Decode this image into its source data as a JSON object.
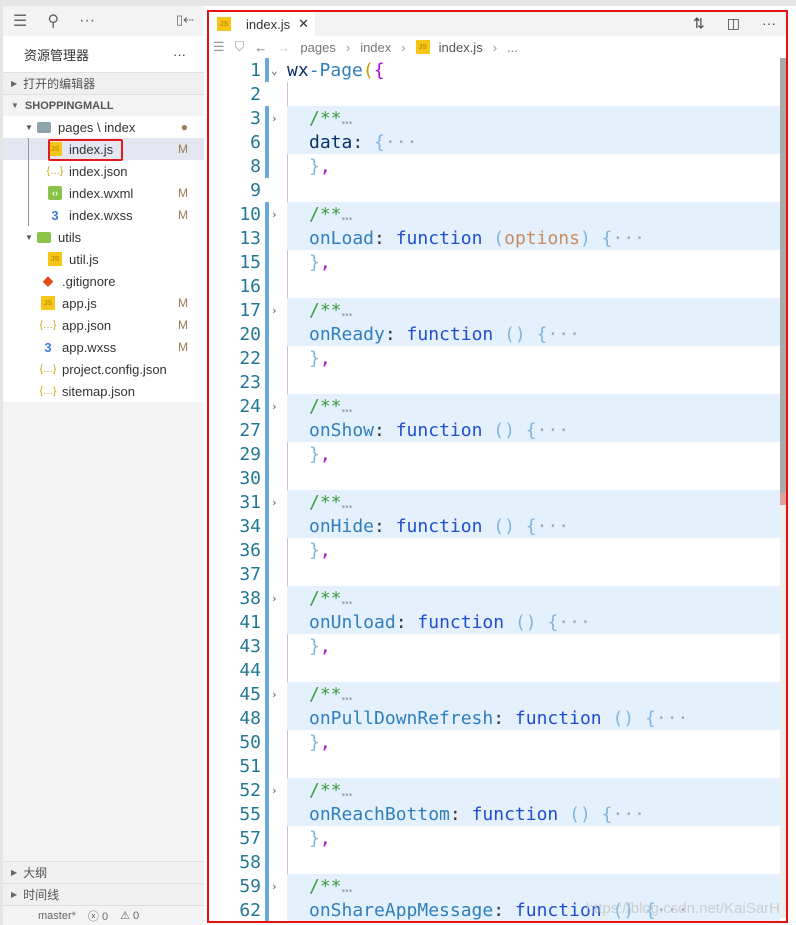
{
  "sidebar": {
    "title": "资源管理器",
    "more": "···",
    "sections": {
      "open_editors": "打开的编辑器",
      "project": "SHOPPINGMALL",
      "outline": "大纲",
      "timeline": "时间线"
    },
    "tree": [
      {
        "name": "pages \\ index",
        "type": "folder",
        "depth": 1,
        "expanded": true,
        "badge": "●"
      },
      {
        "name": "index.js",
        "type": "js",
        "depth": 2,
        "badge": "M",
        "selected": true
      },
      {
        "name": "index.json",
        "type": "json",
        "depth": 2,
        "badge": ""
      },
      {
        "name": "index.wxml",
        "type": "wxml",
        "depth": 2,
        "badge": "M"
      },
      {
        "name": "index.wxss",
        "type": "css",
        "depth": 2,
        "badge": "M"
      },
      {
        "name": "utils",
        "type": "folderg",
        "depth": 1,
        "expanded": true,
        "badge": ""
      },
      {
        "name": "util.js",
        "type": "js",
        "depth": 2,
        "badge": ""
      },
      {
        "name": ".gitignore",
        "type": "git",
        "depth": 1,
        "badge": ""
      },
      {
        "name": "app.js",
        "type": "js",
        "depth": 1,
        "badge": "M"
      },
      {
        "name": "app.json",
        "type": "json",
        "depth": 1,
        "badge": "M"
      },
      {
        "name": "app.wxss",
        "type": "css",
        "depth": 1,
        "badge": "M"
      },
      {
        "name": "project.config.json",
        "type": "json",
        "depth": 1,
        "badge": ""
      },
      {
        "name": "sitemap.json",
        "type": "json",
        "depth": 1,
        "badge": ""
      }
    ],
    "status": {
      "branch": "master*",
      "errors": "ⓧ 0",
      "warnings": "⚠ 0"
    }
  },
  "editor": {
    "tab": "index.js",
    "breadcrumb": [
      "pages",
      "index",
      "index.js",
      "..."
    ],
    "lines": [
      {
        "n": "1",
        "fold": "open",
        "toks": [
          [
            "t-id",
            "wx"
          ],
          [
            "t-fn",
            "-Page"
          ],
          [
            "t-p",
            "("
          ],
          [
            "t-b",
            "{"
          ]
        ]
      },
      {
        "n": "2",
        "toks": []
      },
      {
        "n": "3",
        "fold": "closed",
        "hl": true,
        "ind": true,
        "toks": [
          [
            "t-cm",
            "/**"
          ],
          [
            "t-dim",
            "…"
          ]
        ]
      },
      {
        "n": "6",
        "hl": true,
        "ind": true,
        "toks": [
          [
            "t-id",
            "data"
          ],
          [
            "t-pl",
            ": "
          ],
          [
            "t-par",
            "{"
          ],
          [
            "t-dim",
            "···"
          ]
        ]
      },
      {
        "n": "8",
        "ind": true,
        "toks": [
          [
            "t-par",
            "}"
          ],
          [
            "t-b",
            ","
          ]
        ]
      },
      {
        "n": "9",
        "toks": []
      },
      {
        "n": "10",
        "fold": "closed",
        "hl": true,
        "ind": true,
        "toks": [
          [
            "t-cm",
            "/**"
          ],
          [
            "t-dim",
            "…"
          ]
        ]
      },
      {
        "n": "13",
        "hl": true,
        "ind": true,
        "toks": [
          [
            "t-fn",
            "onLoad"
          ],
          [
            "t-pl",
            ": "
          ],
          [
            "t-kw",
            "function "
          ],
          [
            "t-par",
            "("
          ],
          [
            "t-arg",
            "options"
          ],
          [
            "t-par",
            ") {"
          ],
          [
            "t-dim",
            "···"
          ]
        ]
      },
      {
        "n": "15",
        "ind": true,
        "toks": [
          [
            "t-par",
            "}"
          ],
          [
            "t-b",
            ","
          ]
        ]
      },
      {
        "n": "16",
        "toks": []
      },
      {
        "n": "17",
        "fold": "closed",
        "hl": true,
        "ind": true,
        "toks": [
          [
            "t-cm",
            "/**"
          ],
          [
            "t-dim",
            "…"
          ]
        ]
      },
      {
        "n": "20",
        "hl": true,
        "ind": true,
        "toks": [
          [
            "t-fn",
            "onReady"
          ],
          [
            "t-pl",
            ": "
          ],
          [
            "t-kw",
            "function "
          ],
          [
            "t-par",
            "() {"
          ],
          [
            "t-dim",
            "···"
          ]
        ]
      },
      {
        "n": "22",
        "ind": true,
        "toks": [
          [
            "t-par",
            "}"
          ],
          [
            "t-b",
            ","
          ]
        ]
      },
      {
        "n": "23",
        "toks": []
      },
      {
        "n": "24",
        "fold": "closed",
        "hl": true,
        "ind": true,
        "toks": [
          [
            "t-cm",
            "/**"
          ],
          [
            "t-dim",
            "…"
          ]
        ]
      },
      {
        "n": "27",
        "hl": true,
        "ind": true,
        "toks": [
          [
            "t-fn",
            "onShow"
          ],
          [
            "t-pl",
            ": "
          ],
          [
            "t-kw",
            "function "
          ],
          [
            "t-par",
            "() {"
          ],
          [
            "t-dim",
            "···"
          ]
        ]
      },
      {
        "n": "29",
        "ind": true,
        "toks": [
          [
            "t-par",
            "}"
          ],
          [
            "t-b",
            ","
          ]
        ]
      },
      {
        "n": "30",
        "toks": []
      },
      {
        "n": "31",
        "fold": "closed",
        "hl": true,
        "ind": true,
        "toks": [
          [
            "t-cm",
            "/**"
          ],
          [
            "t-dim",
            "…"
          ]
        ]
      },
      {
        "n": "34",
        "hl": true,
        "ind": true,
        "toks": [
          [
            "t-fn",
            "onHide"
          ],
          [
            "t-pl",
            ": "
          ],
          [
            "t-kw",
            "function "
          ],
          [
            "t-par",
            "() {"
          ],
          [
            "t-dim",
            "···"
          ]
        ]
      },
      {
        "n": "36",
        "ind": true,
        "toks": [
          [
            "t-par",
            "}"
          ],
          [
            "t-b",
            ","
          ]
        ]
      },
      {
        "n": "37",
        "toks": []
      },
      {
        "n": "38",
        "fold": "closed",
        "hl": true,
        "ind": true,
        "toks": [
          [
            "t-cm",
            "/**"
          ],
          [
            "t-dim",
            "…"
          ]
        ]
      },
      {
        "n": "41",
        "hl": true,
        "ind": true,
        "toks": [
          [
            "t-fn",
            "onUnload"
          ],
          [
            "t-pl",
            ": "
          ],
          [
            "t-kw",
            "function "
          ],
          [
            "t-par",
            "() {"
          ],
          [
            "t-dim",
            "···"
          ]
        ]
      },
      {
        "n": "43",
        "ind": true,
        "toks": [
          [
            "t-par",
            "}"
          ],
          [
            "t-b",
            ","
          ]
        ]
      },
      {
        "n": "44",
        "toks": []
      },
      {
        "n": "45",
        "fold": "closed",
        "hl": true,
        "ind": true,
        "toks": [
          [
            "t-cm",
            "/**"
          ],
          [
            "t-dim",
            "…"
          ]
        ]
      },
      {
        "n": "48",
        "hl": true,
        "ind": true,
        "toks": [
          [
            "t-fn",
            "onPullDownRefresh"
          ],
          [
            "t-pl",
            ": "
          ],
          [
            "t-kw",
            "function "
          ],
          [
            "t-par",
            "() {"
          ],
          [
            "t-dim",
            "···"
          ]
        ]
      },
      {
        "n": "50",
        "ind": true,
        "toks": [
          [
            "t-par",
            "}"
          ],
          [
            "t-b",
            ","
          ]
        ]
      },
      {
        "n": "51",
        "toks": []
      },
      {
        "n": "52",
        "fold": "closed",
        "hl": true,
        "ind": true,
        "toks": [
          [
            "t-cm",
            "/**"
          ],
          [
            "t-dim",
            "…"
          ]
        ]
      },
      {
        "n": "55",
        "hl": true,
        "ind": true,
        "toks": [
          [
            "t-fn",
            "onReachBottom"
          ],
          [
            "t-pl",
            ": "
          ],
          [
            "t-kw",
            "function "
          ],
          [
            "t-par",
            "() {"
          ],
          [
            "t-dim",
            "···"
          ]
        ]
      },
      {
        "n": "57",
        "ind": true,
        "toks": [
          [
            "t-par",
            "}"
          ],
          [
            "t-b",
            ","
          ]
        ]
      },
      {
        "n": "58",
        "toks": []
      },
      {
        "n": "59",
        "fold": "closed",
        "hl": true,
        "ind": true,
        "toks": [
          [
            "t-cm",
            "/**"
          ],
          [
            "t-dim",
            "…"
          ]
        ]
      },
      {
        "n": "62",
        "hl": true,
        "ind": true,
        "toks": [
          [
            "t-fn",
            "onShareAppMessage"
          ],
          [
            "t-pl",
            ": "
          ],
          [
            "t-kw",
            "function "
          ],
          [
            "t-par",
            "() {"
          ],
          [
            "t-dim",
            "···"
          ]
        ]
      }
    ]
  },
  "watermark": "https://blog.csdn.net/KaiSarH"
}
